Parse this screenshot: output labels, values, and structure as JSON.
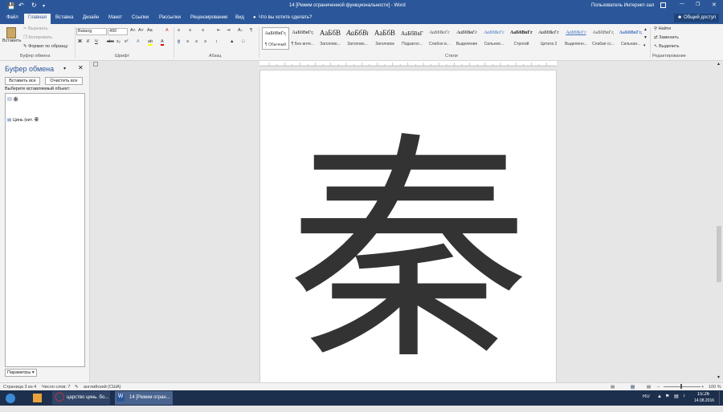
{
  "titlebar": {
    "title": "14 [Режим ограниченной функциональности] - Word",
    "user": "Пользователь Интернет-зал"
  },
  "tabs": {
    "file": "Файл",
    "items": [
      "Главная",
      "Вставка",
      "Дизайн",
      "Макет",
      "Ссылки",
      "Рассылки",
      "Рецензирование",
      "Вид"
    ],
    "tellme": "Что вы хотите сделать?",
    "share": "Общий доступ"
  },
  "ribbon": {
    "paste": "Вставить",
    "cut": "Вырезать",
    "copy": "Копировать",
    "format_painter": "Формат по образцу",
    "group_clipboard": "Буфер обмена",
    "font_name": "Batang",
    "font_size": "490",
    "group_font": "Шрифт",
    "group_paragraph": "Абзац",
    "styles": [
      {
        "sample": "АаБбВвГг,",
        "name": "¶ Обычный"
      },
      {
        "sample": "АаБбВвГг,",
        "name": "¶ Без инте..."
      },
      {
        "sample": "АаБбВ",
        "name": "Заголово..."
      },
      {
        "sample": "АаБбВı",
        "name": "Заголово..."
      },
      {
        "sample": "АаБбВ",
        "name": "Заголовок"
      },
      {
        "sample": "АаБбВвГ",
        "name": "Подзагол..."
      },
      {
        "sample": "АаБбВеГг",
        "name": "Слабое в..."
      },
      {
        "sample": "АаБбВвГг",
        "name": "Выделение"
      },
      {
        "sample": "АаБбВеГг",
        "name": "Сильное..."
      },
      {
        "sample": "АаБбВвГг",
        "name": "Строгий"
      },
      {
        "sample": "АаБбВеГг",
        "name": "Цитата 2"
      },
      {
        "sample": "АаБбВеГг",
        "name": "Выделенн..."
      },
      {
        "sample": "АаБбВвГг,",
        "name": "Слабая сс..."
      },
      {
        "sample": "АаБбВвГг,",
        "name": "Сильная..."
      }
    ],
    "group_styles": "Стили",
    "find": "Найти",
    "replace": "Заменить",
    "select": "Выделить",
    "group_editing": "Редактирование"
  },
  "clipboard_panel": {
    "title": "Буфер обмена",
    "paste_all": "Вставить все",
    "clear_all": "Очистить все",
    "select_item": "Выберите вставляемый объект:",
    "items": [
      "秦",
      "Цинь (кит. 秦"
    ],
    "options": "Параметры"
  },
  "document": {
    "character": "秦"
  },
  "status": {
    "page": "Страница 3 из 4",
    "words": "Число слов: 7",
    "language": "английский (США)",
    "zoom": "100 %"
  },
  "taskbar": {
    "browser_item": "царство цинь. бо...",
    "word_item": "14 [Режим огран...",
    "lang": "RU",
    "time": "15:26",
    "date": "14.08.2016"
  }
}
